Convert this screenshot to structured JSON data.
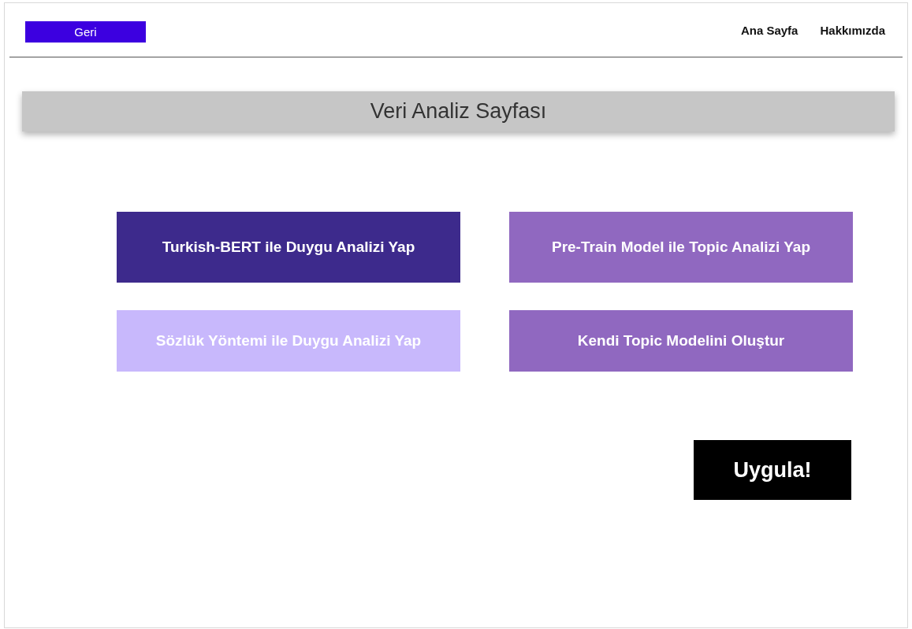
{
  "header": {
    "back_button": "Geri",
    "nav_links": [
      "Ana Sayfa",
      "Hakkımızda"
    ]
  },
  "page_title": "Veri Analiz Sayfası",
  "options": [
    {
      "label": "Turkish-BERT ile Duygu Analizi Yap",
      "color": "#3d2a8c"
    },
    {
      "label": "Pre-Train Model ile Topic Analizi Yap",
      "color": "#9068c0"
    },
    {
      "label": "Sözlük Yöntemi ile Duygu Analizi Yap",
      "color": "#c8b8fc"
    },
    {
      "label": "Kendi Topic Modelini Oluştur",
      "color": "#9068c0"
    }
  ],
  "apply_button": "Uygula!"
}
